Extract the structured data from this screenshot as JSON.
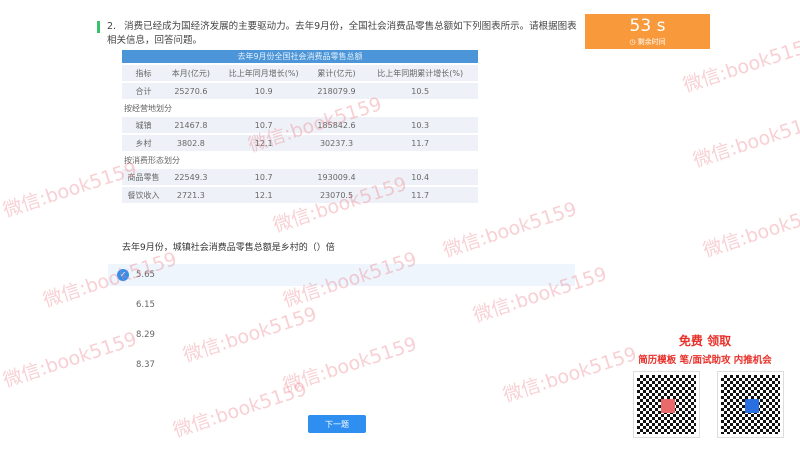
{
  "question": {
    "number": "2.",
    "text": "消费已经成为国经济发展的主要驱动力。去年9月份，全国社会消费品零售总额如下列图表所示。请根据图表相关信息，回答问题。",
    "stem": "去年9月份，城镇社会消费品零售总额是乡村的（）倍"
  },
  "table": {
    "title": "去年9月份全国社会消费品零售总额",
    "headers": [
      "指标",
      "本月(亿元)",
      "比上年同月增长(%)",
      "累计(亿元)",
      "比上年同期累计增长(%)"
    ],
    "total": [
      "合计",
      "25270.6",
      "10.9",
      "218079.9",
      "10.5"
    ],
    "section1": "按经营地划分",
    "rows1": [
      [
        "城镇",
        "21467.8",
        "10.7",
        "185842.6",
        "10.3"
      ],
      [
        "乡村",
        "3802.8",
        "12.1",
        "30237.3",
        "11.7"
      ]
    ],
    "section2": "按消费形态划分",
    "rows2": [
      [
        "商品零售",
        "22549.3",
        "10.7",
        "193009.4",
        "10.4"
      ],
      [
        "餐饮收入",
        "2721.3",
        "12.1",
        "23070.5",
        "11.7"
      ]
    ]
  },
  "timer": {
    "value": "53 s",
    "label": "剩余时间"
  },
  "options": [
    "5.65",
    "6.15",
    "8.29",
    "8.37"
  ],
  "selected_index": 0,
  "next_button": "下一题",
  "promo": {
    "line1": "免费 领取",
    "line2": "简历模板  笔/面试助攻  内推机会"
  },
  "watermark": "微信:book5159"
}
